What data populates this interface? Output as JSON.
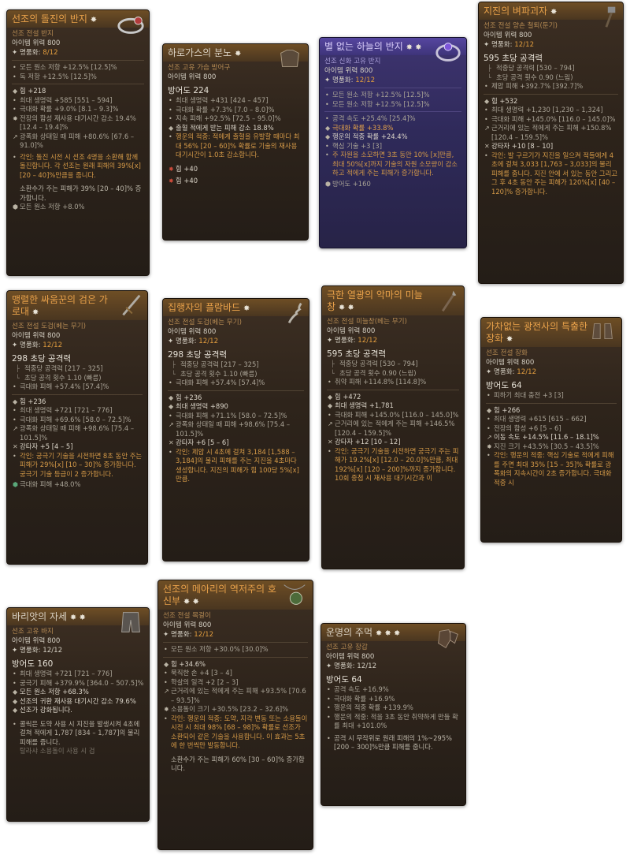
{
  "cards": [
    {
      "id": "c1",
      "name": "선조의 돌진의 반지",
      "gems": "✸",
      "type": "선조 전설 반지",
      "power": "아이템 위력 800",
      "rank_label": "명품화:",
      "rank_value": "8/12",
      "implicit": [
        "모든 원소 저항 +12.5% [12.5]%",
        "독 저항 +12.5% [12.5]%"
      ],
      "affixes": [
        "힘 +218",
        "최대 생명력 +585 [551 – 594]",
        "극대화 확률 +9.0% [8.1 – 9.3]%",
        "전장의 함성 재사용 대기시간 감소 19.4% [12.4 – 19.4]%",
        "광폭화 상태일 때 피해 +80.6% [67.6 – 91.0]%"
      ],
      "aspect": "각인: 돌진 시전 시 선조 4명을 소환해 함께 돌진합니다. 각 선조는 원래 피해의 39%[x] [20 – 40]%만큼을 줍니다.",
      "extra": "소환수가 주는 피해가 39% [20 – 40]% 증가합니다.",
      "socket": "모든 원소 저항 +8.0%",
      "icon": "ring-icon"
    },
    {
      "id": "c2",
      "name": "하로가스의 분노",
      "gems": "✸",
      "type": "선조 고유 가슴 방어구",
      "power": "아이템 위력 800",
      "armor": "방어도 224",
      "affixes": [
        "최대 생명력 +431 [424 – 457]",
        "극대화 확률 +7.3% [7.0 – 8.0]%",
        "지속 피해 +92.5% [72.5 – 95.0]%",
        "출혈 적에게 받는 피해 감소 18.8%"
      ],
      "aspect": "행운의 적중: 적에게 출혈을 유발할 때마다 최대 56% [20 – 60]% 확률로 기술의 재사용 대기시간이 1.0초 감소합니다.",
      "sockets": [
        "힘 +40",
        "힘 +40"
      ],
      "icon": "chest-armor-icon"
    },
    {
      "id": "c3",
      "name": "별 없는 하늘의 반지",
      "gems": "✸ ✸",
      "type": "선조 신화 고유 반지",
      "power": "아이템 위력 800",
      "rank_label": "명품화:",
      "rank_value": "12/12",
      "implicit": [
        "모든 원소 저항 +12.5% [12.5]%",
        "모든 원소 저항 +12.5% [12.5]%"
      ],
      "affixes": [
        "공격 속도 +25.4% [25.4]%",
        "극대화 확률 +33.8%",
        "행운의 적중 확률 +24.4%",
        "핵심 기술 +3 [3]"
      ],
      "aspect": "주 자원을 소모하면 3초 동안 10% [x]만큼, 최대 50%[x]까지 기술의 자원 소모량이 감소하고 적에게 주는 피해가 증가합니다.",
      "socket": "방어도 +160",
      "icon": "ring-purple-icon"
    },
    {
      "id": "c4",
      "name": "지진의 벼파괴자",
      "gems": "✸",
      "type": "선조 전설 양손 철퇴(둔기)",
      "power": "아이템 위력 800",
      "rank_label": "명품화:",
      "rank_value": "12/12",
      "weapon": "595 초당 공격력",
      "tree": [
        "적중당 공격력 [530 – 794]",
        "초당 공격 횟수 0.90 (느림)"
      ],
      "implicit": [
        "제압 피해 +392.7% [392.7]%"
      ],
      "affixes": [
        "힘 +532",
        "최대 생명력 +1,230 [1,230 – 1,324]",
        "극대화 피해 +145.0% [116.0 – 145.0]%",
        "근거리에 있는 적에게 주는 피해 +150.8% [120.4 – 159.5]%",
        "강타자 +10 [8 – 10]"
      ],
      "aspect": "각인: 발 구르기가 지진을 일으켜 적들에게 4초에 걸쳐 3,033 [1,763 – 3,033]의 물리 피해를 줍니다. 지진 안에 서 있는 동안 그리고 그 후 4초 동안 주는 피해가 120%[x] [40 – 120]% 증가합니다.",
      "icon": "maul-icon"
    },
    {
      "id": "c5",
      "name": "맹렬한 싸움꾼의 검은 가로대",
      "gems": "✸",
      "type": "선조 전설 도검(베는 무기)",
      "power": "아이템 위력 800",
      "rank_label": "명품화:",
      "rank_value": "12/12",
      "weapon": "298 초당 공격력",
      "tree": [
        "적중당 공격력 [217 – 325]",
        "초당 공격 횟수 1.10 (빠름)"
      ],
      "implicit": [
        "극대화 피해 +57.4% [57.4]%"
      ],
      "affixes": [
        "힘 +236",
        "최대 생명력 +721 [721 – 776]",
        "극대화 피해 +69.6% [58.0 – 72.5]%",
        "광폭화 상태일 때 피해 +98.6% [75.4 – 101.5]%",
        "강타자 +5 [4 – 5]"
      ],
      "aspect": "각인: 궁극기 기술을 시전하면 8초 동안 주는 피해가 29%[x] [10 – 30]% 증가합니다. 궁극기 기술 등급이 2 증가합니다.",
      "socket": "극대화 피해 +48.0%",
      "icon": "sword-icon"
    },
    {
      "id": "c6",
      "name": "집행자의 플람바드",
      "gems": "✸",
      "type": "선조 전설 도검(베는 무기)",
      "power": "아이템 위력 800",
      "rank_label": "명품화:",
      "rank_value": "12/12",
      "weapon": "298 초당 공격력",
      "tree": [
        "적중당 공격력 [217 – 325]",
        "초당 공격 횟수 1.10 (빠름)"
      ],
      "implicit": [
        "극대화 피해 +57.4% [57.4]%"
      ],
      "affixes": [
        "힘 +236",
        "최대 생명력 +890",
        "극대화 피해 +71.1% [58.0 – 72.5]%",
        "광폭화 상태일 때 피해 +98.6% [75.4 – 101.5]%",
        "강타자 +6 [5 – 6]"
      ],
      "aspect": "각인: 제압 시 4초에 걸쳐 3,184 [1,588 – 3,184]의 물리 피해를 주는 지진을 4초마다 생성합니다. 지진의 피해가 힘 100당 5%[x]만큼.",
      "icon": "flamberge-icon"
    },
    {
      "id": "c7",
      "name": "극한 열광의 악마의 미늘창",
      "gems": "✸ ✸",
      "type": "선조 전설 미늘창(베는 무기)",
      "power": "아이템 위력 800",
      "rank_label": "명품화:",
      "rank_value": "12/12",
      "weapon": "595 초당 공격력",
      "tree": [
        "적중당 공격력 [530 – 794]",
        "초당 공격 횟수 0.90 (느림)"
      ],
      "implicit": [
        "취약 피해 +114.8% [114.8]%"
      ],
      "affixes": [
        "힘 +472",
        "최대 생명력 +1,781",
        "극대화 피해 +145.0% [116.0 – 145.0]%",
        "근거리에 있는 적에게 주는 피해 +146.5% [120.4 – 159.5]%",
        "강타자 +12 [10 – 12]"
      ],
      "aspect": "각인: 궁극기 기술을 시전하면 궁극기 주는 피해가 19.2%[x] [12.0 – 20.0]%만큼, 최대 192%[x] [120 – 200]%까지 증가합니다. 10회 중첩 시 재사용 대기시간과 이",
      "icon": "glaive-icon"
    },
    {
      "id": "c8",
      "name": "가차없는 광전사의 특출한 장화",
      "gems": "✸",
      "type": "선조 전설 장화",
      "power": "아이템 위력 800",
      "rank_label": "명품화:",
      "rank_value": "12/12",
      "armor": "방어도 64",
      "implicit": [
        "피하기 최대 충전 +3 [3]"
      ],
      "affixes": [
        "힘 +266",
        "최대 생명력 +615 [615 – 662]",
        "전장의 함성 +6 [5 – 6]",
        "이동 속도 +14.5% [11.6 – 18.1]%",
        "지진 크기 +43.5% [30.5 – 43.5]%"
      ],
      "aspect": "각인: 행운의 적중: 핵심 기술로 적에게 피해를 주면 최대 35% [15 – 35]% 확률로 광폭화의 지속시간이 2초 증가합니다. 극대화 적중 시",
      "icon": "boots-icon"
    },
    {
      "id": "c9",
      "name": "바리앗의 자세",
      "gems": "✸ ✸",
      "type": "선조 고유 바지",
      "power": "아이템 위력 800",
      "rank_label": "명품화:",
      "rank_value": "12/12",
      "armor": "방어도 160",
      "affixes": [
        "최대 생명력 +721 [721 – 776]",
        "궁극기 피해 +379.9% [364.0 – 507.5]%",
        "모든 원소 저항 +68.3%",
        "선조의 귀환 재사용 대기시간 감소 79.6%",
        "선조가 강화됩니다."
      ],
      "aspect": "콜릭은 도약 사용 시 지진을 발생시켜 4초에 걸쳐 적에게 1,787 [834 – 1,787]의 물리 피해를 줍니다.",
      "tail": "탈라샤 소용돌이 사용 시 검",
      "icon": "pants-icon"
    },
    {
      "id": "c10",
      "name": "선조의 메아리의 역저주의 호신부",
      "gems": "✸ ✸",
      "type": "선조 전설 목걸이",
      "power": "아이템 위력 800",
      "rank_label": "명품화:",
      "rank_value": "12/12",
      "implicit": [
        "모든 원소 저항 +30.0% [30.0]%"
      ],
      "affixes": [
        "힘 +34.6%",
        "묵직한 손 +4 [3 – 4]",
        "학살의 일격 +2 [2 – 3]",
        "근거리에 있는 적에게 주는 피해 +93.5% [70.6 – 93.5]%",
        "소용돌이 크기 +30.5% [23.2 – 32.6]%"
      ],
      "aspect": "각인: 행운의 적중: 도약, 지각 변동 또는 소용돌이 시전 시 최대 98% [68 – 98]% 확률로 선조가 소환되어 같은 기술을 사용합니다. 이 효과는 5초에 한 번씩만 발동합니다.",
      "extra": "소환수가 주는 피해가 60% [30 – 60]% 증가합니다.",
      "icon": "amulet-icon"
    },
    {
      "id": "c11",
      "name": "운명의 주먹",
      "gems": "✸ ✸ ✸",
      "type": "선조 고유 장갑",
      "power": "아이템 위력 800",
      "rank_label": "명품화:",
      "rank_value": "12/12",
      "armor": "방어도 64",
      "affixes": [
        "공격 속도 +16.9%",
        "극대화 확률 +16.9%",
        "행운의 적중 확률 +139.9%",
        "행운의 적중: 적을 3초 동안 취약하게 만들 확률 최대 +101.0%"
      ],
      "aspect": "공격 시 무작위로 원래 피해의 1%~295% [200 – 300]%만큼 피해를 줍니다.",
      "icon": "gloves-icon"
    }
  ]
}
